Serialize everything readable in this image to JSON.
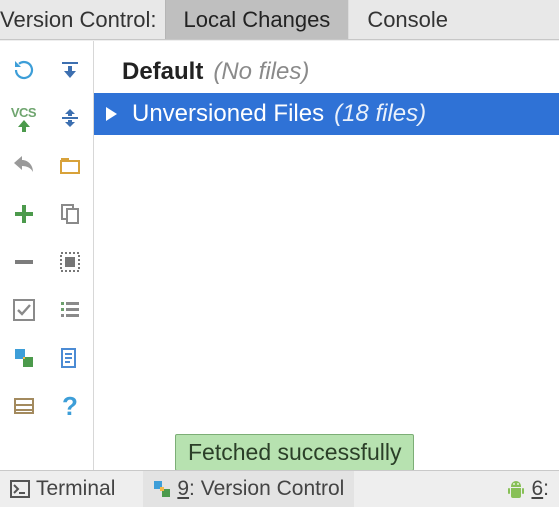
{
  "header": {
    "title": "Version Control:",
    "tabs": [
      {
        "label": "Local Changes",
        "active": true
      },
      {
        "label": "Console",
        "active": false
      }
    ]
  },
  "changes": {
    "default": {
      "label": "Default",
      "note": "(No files)"
    },
    "unversioned": {
      "label": "Unversioned Files",
      "note": "(18 files)"
    }
  },
  "tooltip": {
    "text": "Fetched successfully"
  },
  "bottombar": {
    "terminal": "Terminal",
    "vc_prefix": "9",
    "vc_label": ": Version Control",
    "right_prefix": "6",
    "right_suffix": ":"
  },
  "toolbar": {
    "refresh": "Refresh",
    "vcs": "VCS",
    "commit": "Commit",
    "revert": "Revert",
    "add": "Add",
    "remove": "Remove",
    "check": "Toggle",
    "diff": "Diff",
    "shelve": "Shelve",
    "help": "?",
    "expand": "Expand",
    "collapse": "Collapse",
    "group": "Group",
    "copy": "Copy",
    "preview": "Preview",
    "list": "List",
    "changes": "Changes"
  }
}
